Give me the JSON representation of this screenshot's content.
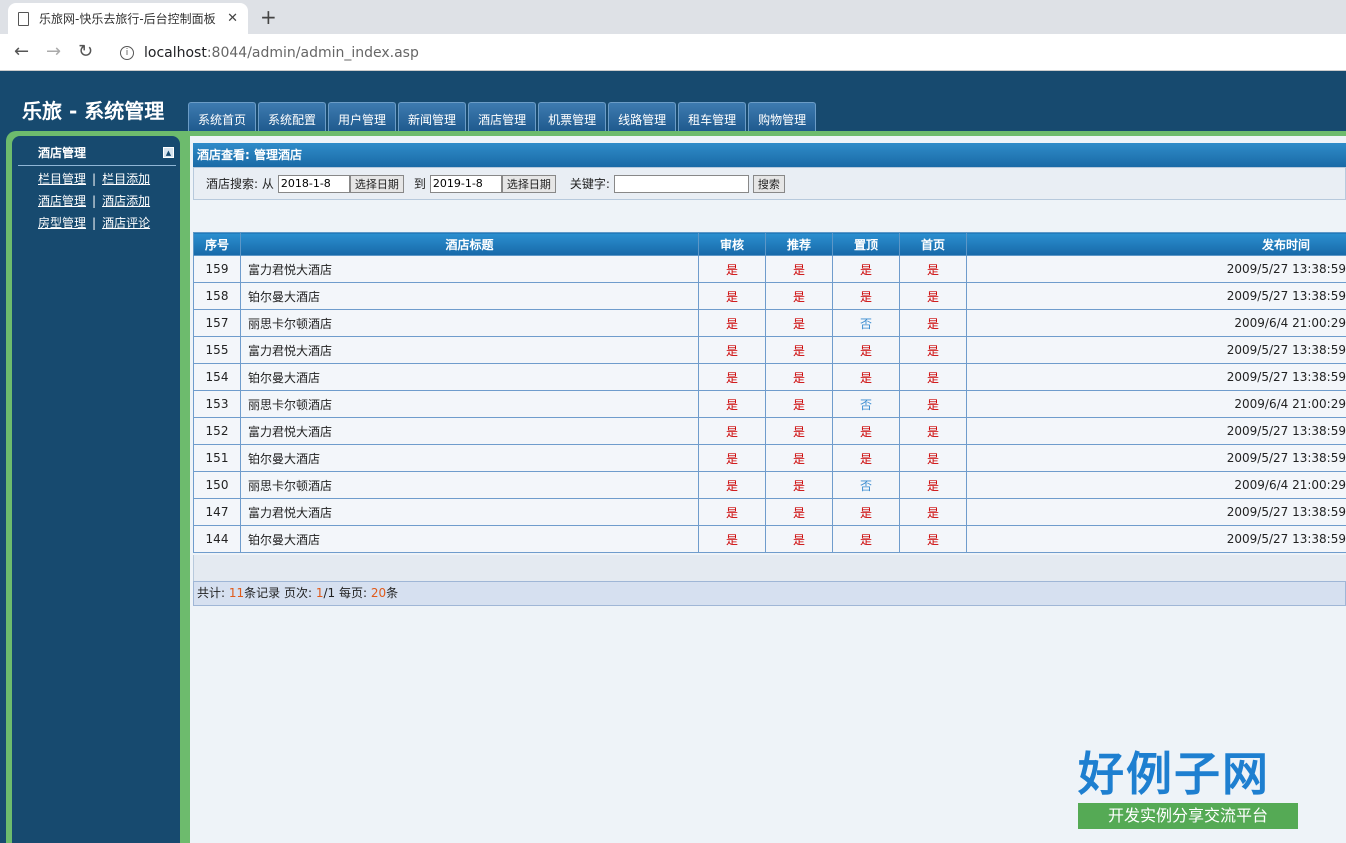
{
  "browser": {
    "tab_title": "乐旅网-快乐去旅行-后台控制面板",
    "close": "✕",
    "new_tab": "+",
    "url_host": "localhost",
    "url_path": ":8044/admin/admin_index.asp"
  },
  "header": {
    "brand": "乐旅 - 系统管理",
    "nav": [
      "系统首页",
      "系统配置",
      "用户管理",
      "新闻管理",
      "酒店管理",
      "机票管理",
      "线路管理",
      "租车管理",
      "购物管理"
    ]
  },
  "sidebar": {
    "title": "酒店管理",
    "rows": [
      [
        "栏目管理",
        "栏目添加"
      ],
      [
        "酒店管理",
        "酒店添加"
      ],
      [
        "房型管理",
        "酒店评论"
      ]
    ],
    "separator": "|"
  },
  "main": {
    "panel_title": "酒店查看: 管理酒店",
    "search": {
      "label": "酒店搜索: 从",
      "from_value": "2018-1-8",
      "pick_date": "选择日期",
      "to_label": "到",
      "to_value": "2019-1-8",
      "keyword_label": "关键字:",
      "keyword_value": "",
      "search_button": "搜索"
    },
    "table": {
      "headers": [
        "序号",
        "酒店标题",
        "审核",
        "推荐",
        "置顶",
        "首页",
        "发布时间"
      ],
      "rows": [
        [
          "159",
          "富力君悦大酒店",
          "是",
          "是",
          "是",
          "是",
          "2009/5/27 13:38:59"
        ],
        [
          "158",
          "铂尔曼大酒店",
          "是",
          "是",
          "是",
          "是",
          "2009/5/27 13:38:59"
        ],
        [
          "157",
          "丽思卡尔顿酒店",
          "是",
          "是",
          "否",
          "是",
          "2009/6/4 21:00:29"
        ],
        [
          "155",
          "富力君悦大酒店",
          "是",
          "是",
          "是",
          "是",
          "2009/5/27 13:38:59"
        ],
        [
          "154",
          "铂尔曼大酒店",
          "是",
          "是",
          "是",
          "是",
          "2009/5/27 13:38:59"
        ],
        [
          "153",
          "丽思卡尔顿酒店",
          "是",
          "是",
          "否",
          "是",
          "2009/6/4 21:00:29"
        ],
        [
          "152",
          "富力君悦大酒店",
          "是",
          "是",
          "是",
          "是",
          "2009/5/27 13:38:59"
        ],
        [
          "151",
          "铂尔曼大酒店",
          "是",
          "是",
          "是",
          "是",
          "2009/5/27 13:38:59"
        ],
        [
          "150",
          "丽思卡尔顿酒店",
          "是",
          "是",
          "否",
          "是",
          "2009/6/4 21:00:29"
        ],
        [
          "147",
          "富力君悦大酒店",
          "是",
          "是",
          "是",
          "是",
          "2009/5/27 13:38:59"
        ],
        [
          "144",
          "铂尔曼大酒店",
          "是",
          "是",
          "是",
          "是",
          "2009/5/27 13:38:59"
        ]
      ]
    },
    "pager": {
      "total_prefix": "共计: ",
      "total": "11",
      "total_suffix": "条记录 页次: ",
      "page": "1",
      "page_suffix": "/1 每页: ",
      "per_page": "20",
      "per_suffix": "条"
    }
  },
  "watermark": {
    "logo_big": "好例子网",
    "logo_small": "开发实例分享交流平台"
  },
  "colors": {
    "header_bg": "#174a6f",
    "green_border": "#6dbb6d",
    "yes": "#cc0000",
    "no": "#3a8cd0",
    "pager_num": "#e05a1a"
  }
}
